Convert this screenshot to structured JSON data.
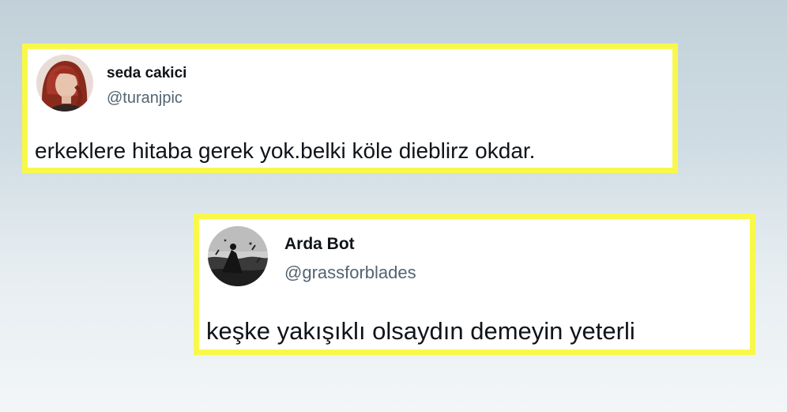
{
  "tweets": [
    {
      "name": "seda cakici",
      "handle": "@turanjpic",
      "text": "erkeklere hitaba gerek yok.belki köle dieblirz okdar.",
      "avatar_icon": "profile-photo-red-hair"
    },
    {
      "name": "Arda Bot",
      "handle": "@grassforblades",
      "text": "keşke yakışıklı olsaydın demeyin yeterli",
      "avatar_icon": "profile-photo-monochrome-artwork"
    }
  ],
  "colors": {
    "highlight_border": "#f8f84a",
    "name_text": "#0f1419",
    "handle_text": "#536471",
    "card_background": "#ffffff"
  }
}
